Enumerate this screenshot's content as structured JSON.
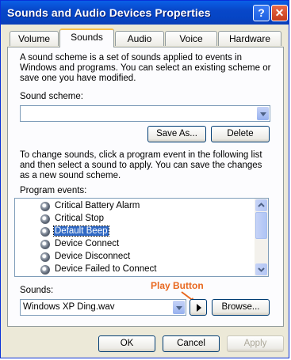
{
  "window": {
    "title": "Sounds and Audio Devices Properties",
    "help_label": "?",
    "close_label": "✕"
  },
  "tabs": [
    {
      "label": "Volume"
    },
    {
      "label": "Sounds"
    },
    {
      "label": "Audio"
    },
    {
      "label": "Voice"
    },
    {
      "label": "Hardware"
    }
  ],
  "sounds_tab": {
    "scheme_description": "A sound scheme is a set of sounds applied to events in Windows and programs. You can select an existing scheme or save one you have modified.",
    "scheme_label": "Sound scheme:",
    "scheme_value": "",
    "save_as_label": "Save As...",
    "delete_label": "Delete",
    "events_description": "To change sounds, click a program event in the following list and then select a sound to apply. You can save the changes as a new sound scheme.",
    "events_label": "Program events:",
    "events": [
      {
        "label": "Critical Battery Alarm"
      },
      {
        "label": "Critical Stop"
      },
      {
        "label": "Default Beep",
        "selected": true
      },
      {
        "label": "Device Connect"
      },
      {
        "label": "Device Disconnect"
      },
      {
        "label": "Device Failed to Connect"
      }
    ],
    "sounds_label": "Sounds:",
    "sound_value": "Windows XP Ding.wav",
    "browse_label": "Browse...",
    "annotation": "Play Button"
  },
  "footer": {
    "ok_label": "OK",
    "cancel_label": "Cancel",
    "apply_label": "Apply"
  },
  "icons": [
    "speaker-icon",
    "play-icon",
    "chevron-down-icon",
    "scroll-up-icon",
    "scroll-down-icon",
    "close-icon",
    "help-icon"
  ]
}
